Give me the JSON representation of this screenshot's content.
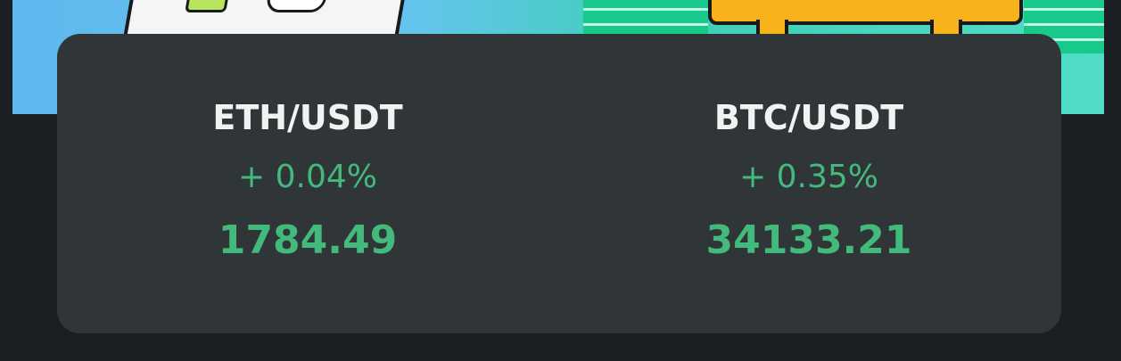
{
  "tickers": [
    {
      "pair": "ETH/USDT",
      "change": "+ 0.04%",
      "price": "1784.49"
    },
    {
      "pair": "BTC/USDT",
      "change": "+ 0.35%",
      "price": "34133.21"
    }
  ],
  "colors": {
    "positive": "#43b97c",
    "card_bg": "#303638",
    "page_bg": "#1b1f24",
    "pair_text": "#f1f3f3"
  }
}
